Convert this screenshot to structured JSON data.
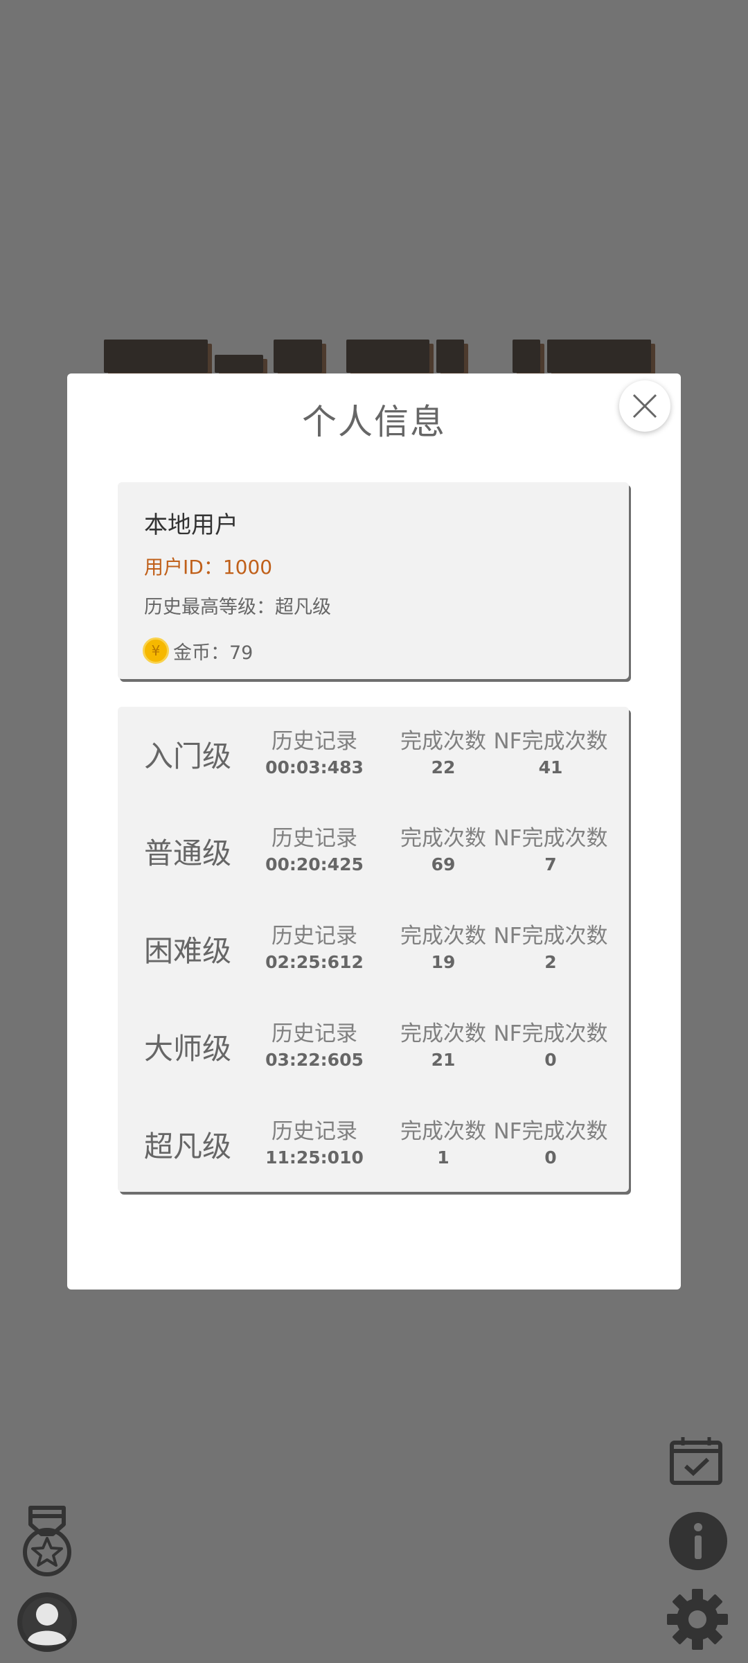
{
  "dialog": {
    "title": "个人信息",
    "close_icon": "close-icon"
  },
  "profile": {
    "username": "本地用户",
    "user_id": "用户ID：1000",
    "max_level": "历史最高等级：超凡级",
    "coin_label": "金币：79",
    "coin_symbol": "¥"
  },
  "stats": {
    "record_label": "历史记录",
    "completions_label": "完成次数",
    "nf_completions_label": "NF完成次数",
    "rows": [
      {
        "level": "入门级",
        "record": "00:03:483",
        "completions": "22",
        "nf_completions": "41"
      },
      {
        "level": "普通级",
        "record": "00:20:425",
        "completions": "69",
        "nf_completions": "7"
      },
      {
        "level": "困难级",
        "record": "02:25:612",
        "completions": "19",
        "nf_completions": "2"
      },
      {
        "level": "大师级",
        "record": "03:22:605",
        "completions": "21",
        "nf_completions": "0"
      },
      {
        "level": "超凡级",
        "record": "11:25:010",
        "completions": "1",
        "nf_completions": "0"
      }
    ]
  },
  "side_icons": [
    "medal-icon",
    "user-avatar-icon",
    "calendar-check-icon",
    "info-icon",
    "gear-icon"
  ],
  "colors": {
    "overlay": "#737373",
    "user_id": "#c0601a",
    "coin": "#f6b800"
  }
}
